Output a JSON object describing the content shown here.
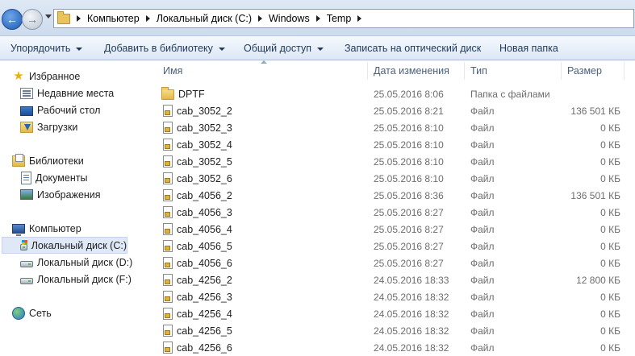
{
  "address": {
    "crumbs": [
      "Компьютер",
      "Локальный диск (C:)",
      "Windows",
      "Temp"
    ]
  },
  "toolbar": {
    "organize": "Упорядочить",
    "add_to_library": "Добавить в библиотеку",
    "share": "Общий доступ",
    "burn": "Записать на оптический диск",
    "new_folder": "Новая папка"
  },
  "nav": {
    "favorites": "Избранное",
    "recent": "Недавние места",
    "desktop": "Рабочий стол",
    "downloads": "Загрузки",
    "libraries": "Библиотеки",
    "documents": "Документы",
    "images": "Изображения",
    "computer": "Компьютер",
    "drive_c": "Локальный диск (C:)",
    "drive_d": "Локальный диск (D:)",
    "drive_f": "Локальный диск (F:)",
    "network": "Сеть"
  },
  "columns": {
    "name": "Имя",
    "date": "Дата изменения",
    "type": "Тип",
    "size": "Размер"
  },
  "files": [
    {
      "name": "DPTF",
      "date": "25.05.2016 8:06",
      "type": "Папка с файлами",
      "size": "",
      "icon": "folder-icon"
    },
    {
      "name": "cab_3052_2",
      "date": "25.05.2016 8:21",
      "type": "Файл",
      "size": "136 501 КБ",
      "icon": "file-icon"
    },
    {
      "name": "cab_3052_3",
      "date": "25.05.2016 8:10",
      "type": "Файл",
      "size": "0 КБ",
      "icon": "file-icon"
    },
    {
      "name": "cab_3052_4",
      "date": "25.05.2016 8:10",
      "type": "Файл",
      "size": "0 КБ",
      "icon": "file-icon"
    },
    {
      "name": "cab_3052_5",
      "date": "25.05.2016 8:10",
      "type": "Файл",
      "size": "0 КБ",
      "icon": "file-icon"
    },
    {
      "name": "cab_3052_6",
      "date": "25.05.2016 8:10",
      "type": "Файл",
      "size": "0 КБ",
      "icon": "file-icon"
    },
    {
      "name": "cab_4056_2",
      "date": "25.05.2016 8:36",
      "type": "Файл",
      "size": "136 501 КБ",
      "icon": "file-icon"
    },
    {
      "name": "cab_4056_3",
      "date": "25.05.2016 8:27",
      "type": "Файл",
      "size": "0 КБ",
      "icon": "file-icon"
    },
    {
      "name": "cab_4056_4",
      "date": "25.05.2016 8:27",
      "type": "Файл",
      "size": "0 КБ",
      "icon": "file-icon"
    },
    {
      "name": "cab_4056_5",
      "date": "25.05.2016 8:27",
      "type": "Файл",
      "size": "0 КБ",
      "icon": "file-icon"
    },
    {
      "name": "cab_4056_6",
      "date": "25.05.2016 8:27",
      "type": "Файл",
      "size": "0 КБ",
      "icon": "file-icon"
    },
    {
      "name": "cab_4256_2",
      "date": "24.05.2016 18:33",
      "type": "Файл",
      "size": "12 800 КБ",
      "icon": "file-icon"
    },
    {
      "name": "cab_4256_3",
      "date": "24.05.2016 18:32",
      "type": "Файл",
      "size": "0 КБ",
      "icon": "file-icon"
    },
    {
      "name": "cab_4256_4",
      "date": "24.05.2016 18:32",
      "type": "Файл",
      "size": "0 КБ",
      "icon": "file-icon"
    },
    {
      "name": "cab_4256_5",
      "date": "24.05.2016 18:32",
      "type": "Файл",
      "size": "0 КБ",
      "icon": "file-icon"
    },
    {
      "name": "cab_4256_6",
      "date": "24.05.2016 18:32",
      "type": "Файл",
      "size": "0 КБ",
      "icon": "file-icon"
    }
  ]
}
